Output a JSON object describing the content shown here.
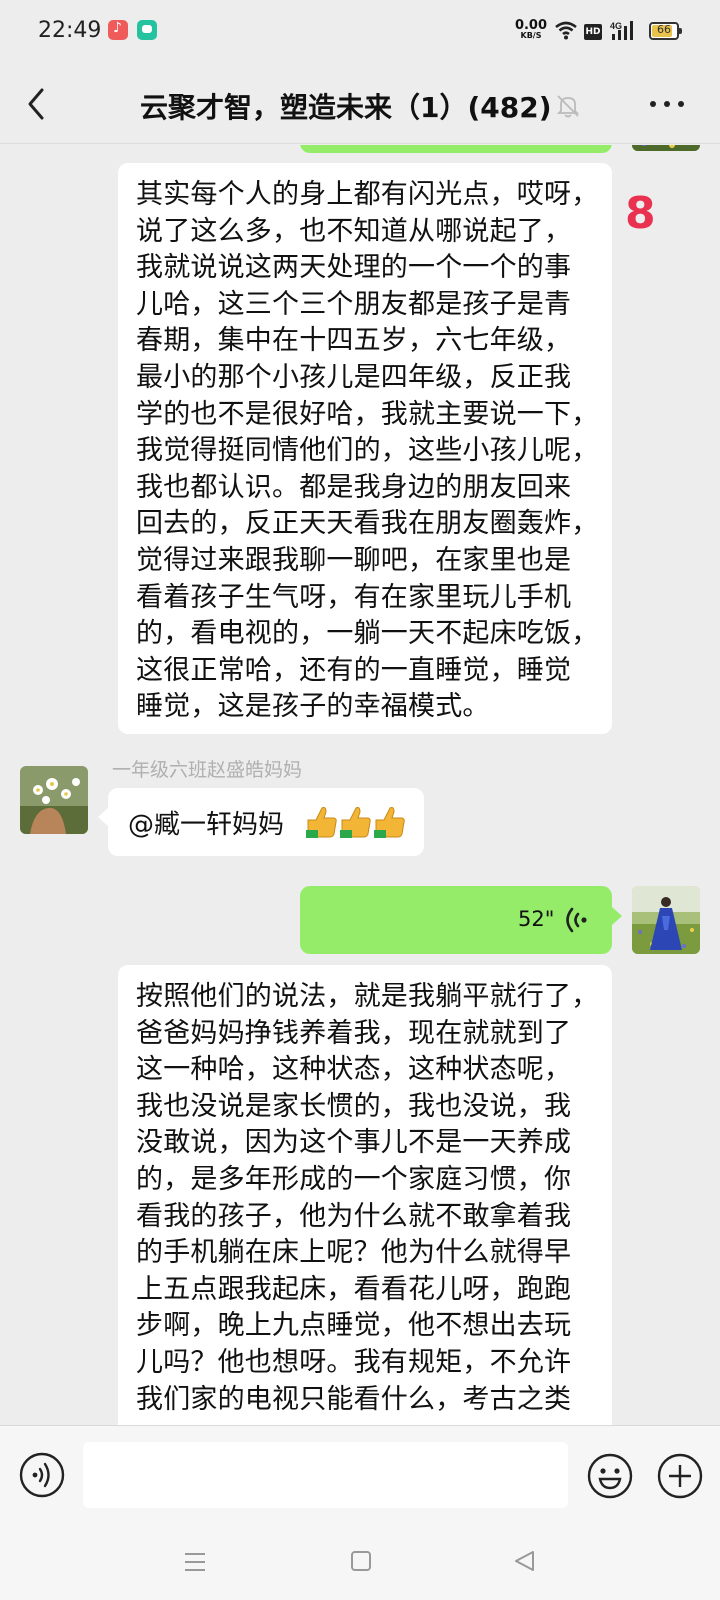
{
  "status_bar": {
    "time": "22:49",
    "net_speed": "0.00",
    "net_speed_unit": "KB/S",
    "hd_label": "HD",
    "network_label": "4G",
    "battery_level": "66"
  },
  "header": {
    "title": "云聚才智，塑造未来（1）(482)"
  },
  "messages": [
    {
      "type": "text",
      "direction": "incoming",
      "text": "其实每个人的身上都有闪光点，哎呀，\n说了这么多，也不知道从哪说起了，\n我就说说这两天处理的一个一个的事\n儿哈，这三个三个朋友都是孩子是青\n春期，集中在十四五岁，六七年级，\n最小的那个小孩儿是四年级，反正我\n学的也不是很好哈，我就主要说一下，\n我觉得挺同情他们的，这些小孩儿呢，\n我也都认识。都是我身边的朋友回来\n回去的，反正天天看我在朋友圈轰炸，\n觉得过来跟我聊一聊吧，在家里也是\n看着孩子生气呀，有在家里玩儿手机\n的，看电视的，一躺一天不起床吃饭，\n这很正常哈，还有的一直睡觉，睡觉\n睡觉，这是孩子的幸福模式。"
    },
    {
      "type": "text",
      "direction": "incoming",
      "sender": "一年级六班赵盛皓妈妈",
      "text": "@臧一轩妈妈",
      "emoji_count": 3
    },
    {
      "type": "voice",
      "direction": "outgoing",
      "duration": "52\""
    },
    {
      "type": "text",
      "direction": "incoming",
      "text": "按照他们的说法，就是我躺平就行了，\n爸爸妈妈挣钱养着我，现在就就到了\n这一种哈，这种状态，这种状态呢，\n我也没说是家长惯的，我也没说，我\n没敢说，因为这个事儿不是一天养成\n的，是多年形成的一个家庭习惯，你\n看我的孩子，他为什么就不敢拿着我\n的手机躺在床上呢？他为什么就得早\n上五点跟我起床，看看花儿呀，跑跑\n步啊，晚上九点睡觉，他不想出去玩\n儿吗？他也想呀。我有规矩，不允许\n我们家的电视只能看什么，考古之类"
    }
  ],
  "unread_marker": "8",
  "input": {
    "value": "",
    "placeholder": ""
  },
  "colors": {
    "background": "#ededed",
    "outgoing_bubble": "#95ec69",
    "incoming_bubble": "#ffffff",
    "marker": "#e8324f",
    "sender_name": "#b0b0b0"
  }
}
